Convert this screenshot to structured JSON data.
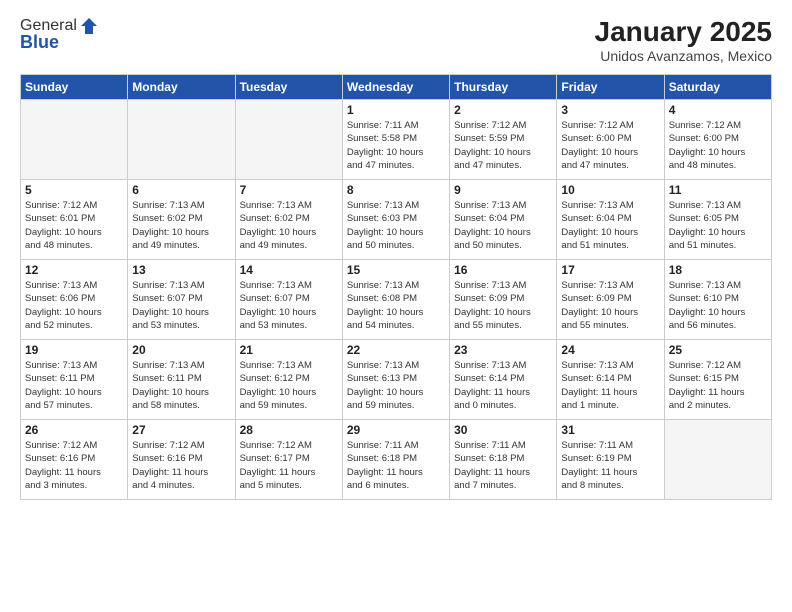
{
  "logo": {
    "general": "General",
    "blue": "Blue"
  },
  "header": {
    "month_year": "January 2025",
    "location": "Unidos Avanzamos, Mexico"
  },
  "weekdays": [
    "Sunday",
    "Monday",
    "Tuesday",
    "Wednesday",
    "Thursday",
    "Friday",
    "Saturday"
  ],
  "weeks": [
    [
      {
        "day": "",
        "info": ""
      },
      {
        "day": "",
        "info": ""
      },
      {
        "day": "",
        "info": ""
      },
      {
        "day": "1",
        "info": "Sunrise: 7:11 AM\nSunset: 5:58 PM\nDaylight: 10 hours\nand 47 minutes."
      },
      {
        "day": "2",
        "info": "Sunrise: 7:12 AM\nSunset: 5:59 PM\nDaylight: 10 hours\nand 47 minutes."
      },
      {
        "day": "3",
        "info": "Sunrise: 7:12 AM\nSunset: 6:00 PM\nDaylight: 10 hours\nand 47 minutes."
      },
      {
        "day": "4",
        "info": "Sunrise: 7:12 AM\nSunset: 6:00 PM\nDaylight: 10 hours\nand 48 minutes."
      }
    ],
    [
      {
        "day": "5",
        "info": "Sunrise: 7:12 AM\nSunset: 6:01 PM\nDaylight: 10 hours\nand 48 minutes."
      },
      {
        "day": "6",
        "info": "Sunrise: 7:13 AM\nSunset: 6:02 PM\nDaylight: 10 hours\nand 49 minutes."
      },
      {
        "day": "7",
        "info": "Sunrise: 7:13 AM\nSunset: 6:02 PM\nDaylight: 10 hours\nand 49 minutes."
      },
      {
        "day": "8",
        "info": "Sunrise: 7:13 AM\nSunset: 6:03 PM\nDaylight: 10 hours\nand 50 minutes."
      },
      {
        "day": "9",
        "info": "Sunrise: 7:13 AM\nSunset: 6:04 PM\nDaylight: 10 hours\nand 50 minutes."
      },
      {
        "day": "10",
        "info": "Sunrise: 7:13 AM\nSunset: 6:04 PM\nDaylight: 10 hours\nand 51 minutes."
      },
      {
        "day": "11",
        "info": "Sunrise: 7:13 AM\nSunset: 6:05 PM\nDaylight: 10 hours\nand 51 minutes."
      }
    ],
    [
      {
        "day": "12",
        "info": "Sunrise: 7:13 AM\nSunset: 6:06 PM\nDaylight: 10 hours\nand 52 minutes."
      },
      {
        "day": "13",
        "info": "Sunrise: 7:13 AM\nSunset: 6:07 PM\nDaylight: 10 hours\nand 53 minutes."
      },
      {
        "day": "14",
        "info": "Sunrise: 7:13 AM\nSunset: 6:07 PM\nDaylight: 10 hours\nand 53 minutes."
      },
      {
        "day": "15",
        "info": "Sunrise: 7:13 AM\nSunset: 6:08 PM\nDaylight: 10 hours\nand 54 minutes."
      },
      {
        "day": "16",
        "info": "Sunrise: 7:13 AM\nSunset: 6:09 PM\nDaylight: 10 hours\nand 55 minutes."
      },
      {
        "day": "17",
        "info": "Sunrise: 7:13 AM\nSunset: 6:09 PM\nDaylight: 10 hours\nand 55 minutes."
      },
      {
        "day": "18",
        "info": "Sunrise: 7:13 AM\nSunset: 6:10 PM\nDaylight: 10 hours\nand 56 minutes."
      }
    ],
    [
      {
        "day": "19",
        "info": "Sunrise: 7:13 AM\nSunset: 6:11 PM\nDaylight: 10 hours\nand 57 minutes."
      },
      {
        "day": "20",
        "info": "Sunrise: 7:13 AM\nSunset: 6:11 PM\nDaylight: 10 hours\nand 58 minutes."
      },
      {
        "day": "21",
        "info": "Sunrise: 7:13 AM\nSunset: 6:12 PM\nDaylight: 10 hours\nand 59 minutes."
      },
      {
        "day": "22",
        "info": "Sunrise: 7:13 AM\nSunset: 6:13 PM\nDaylight: 10 hours\nand 59 minutes."
      },
      {
        "day": "23",
        "info": "Sunrise: 7:13 AM\nSunset: 6:14 PM\nDaylight: 11 hours\nand 0 minutes."
      },
      {
        "day": "24",
        "info": "Sunrise: 7:13 AM\nSunset: 6:14 PM\nDaylight: 11 hours\nand 1 minute."
      },
      {
        "day": "25",
        "info": "Sunrise: 7:12 AM\nSunset: 6:15 PM\nDaylight: 11 hours\nand 2 minutes."
      }
    ],
    [
      {
        "day": "26",
        "info": "Sunrise: 7:12 AM\nSunset: 6:16 PM\nDaylight: 11 hours\nand 3 minutes."
      },
      {
        "day": "27",
        "info": "Sunrise: 7:12 AM\nSunset: 6:16 PM\nDaylight: 11 hours\nand 4 minutes."
      },
      {
        "day": "28",
        "info": "Sunrise: 7:12 AM\nSunset: 6:17 PM\nDaylight: 11 hours\nand 5 minutes."
      },
      {
        "day": "29",
        "info": "Sunrise: 7:11 AM\nSunset: 6:18 PM\nDaylight: 11 hours\nand 6 minutes."
      },
      {
        "day": "30",
        "info": "Sunrise: 7:11 AM\nSunset: 6:18 PM\nDaylight: 11 hours\nand 7 minutes."
      },
      {
        "day": "31",
        "info": "Sunrise: 7:11 AM\nSunset: 6:19 PM\nDaylight: 11 hours\nand 8 minutes."
      },
      {
        "day": "",
        "info": ""
      }
    ]
  ]
}
